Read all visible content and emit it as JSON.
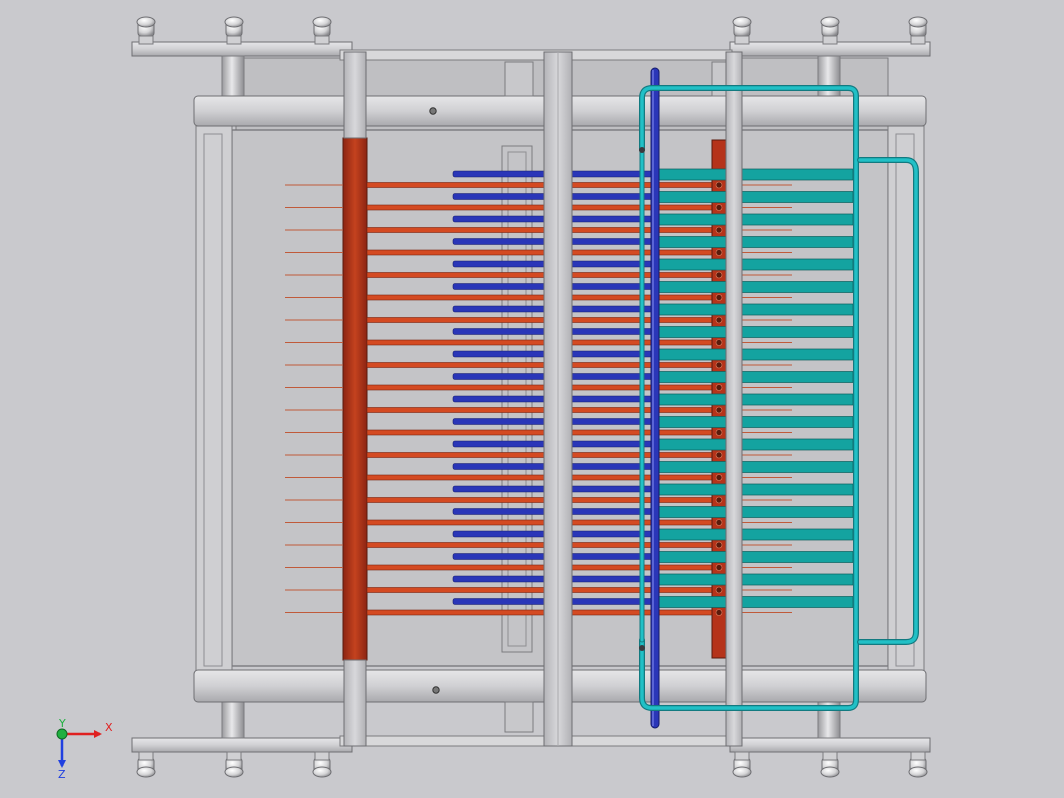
{
  "viewport": {
    "background": "#c9c9cd",
    "view": "cad-3d-model-front-view"
  },
  "model": {
    "colors": {
      "frame_light": "#dcdcde",
      "frame_mid": "#bdbdc0",
      "frame_dark": "#6e6e72",
      "panel": "#b9b9bc",
      "red_bar": "#b5331a",
      "red_rod": "#d44a22",
      "blue_rod": "#2a36b8",
      "teal_plate": "#14a3a0",
      "cyan_pipe": "#21c0c6",
      "bolt": "#d8d8da"
    },
    "rod_count": 20,
    "components": [
      "top-mounting-bar",
      "bottom-mounting-bar",
      "support-pillars",
      "upper-crossbeam",
      "lower-crossbeam",
      "red-busbar",
      "red-electrode-rods",
      "blue-electrode-rods",
      "blue-vertical-manifold",
      "teal-cooling-plates",
      "cyan-cooling-loop"
    ]
  },
  "triad": {
    "x_label": "X",
    "y_label": "Y",
    "z_label": "Z",
    "x_color": "#e02020",
    "y_color": "#20b040",
    "z_color": "#2040e0",
    "icon": "coordinate-triad-icon"
  }
}
